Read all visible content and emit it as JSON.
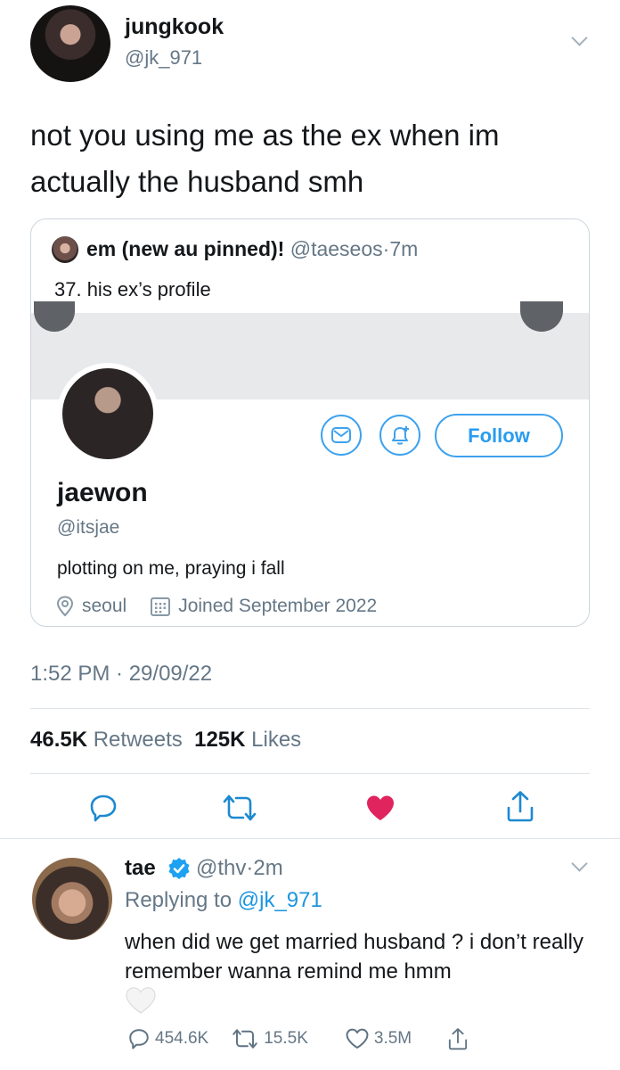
{
  "tweet": {
    "author_name": "jungkook",
    "author_handle": "@jk_971",
    "text": "not you using me as the ex when im actually the husband smh",
    "timestamp": "1:52 PM · 29/09/22",
    "retweets_count": "46.5K",
    "retweets_label": "Retweets",
    "likes_count": "125K",
    "likes_label": "Likes",
    "liked": true,
    "like_color": "#e0245e"
  },
  "quote": {
    "author_name": "em (new au pinned)!",
    "author_handle": "@taeseos",
    "time": "7m",
    "text": "37. his ex’s profile",
    "profile": {
      "name": "jaewon",
      "handle": "@itsjae",
      "bio": "plotting on me, praying i fall",
      "location": "seoul",
      "joined": "Joined September 2022",
      "follow_label": "Follow",
      "accent": "#1da1f2"
    }
  },
  "reply": {
    "author_name": "tae",
    "verified": true,
    "author_handle": "@thv",
    "time": "2m",
    "replying_label": "Replying to",
    "replying_handle": "@jk_971",
    "text": "when did we get married husband ? i don’t really remember wanna remind me hmm",
    "reply_count": "454.6K",
    "retweet_count": "15.5K",
    "like_count": "3.5M"
  },
  "icons": [
    "chevron-down-icon",
    "location-icon",
    "calendar-icon",
    "mail-icon",
    "bell-plus-icon",
    "reply-icon",
    "retweet-icon",
    "heart-icon",
    "share-icon",
    "verified-icon",
    "emoji-heart-icon"
  ]
}
